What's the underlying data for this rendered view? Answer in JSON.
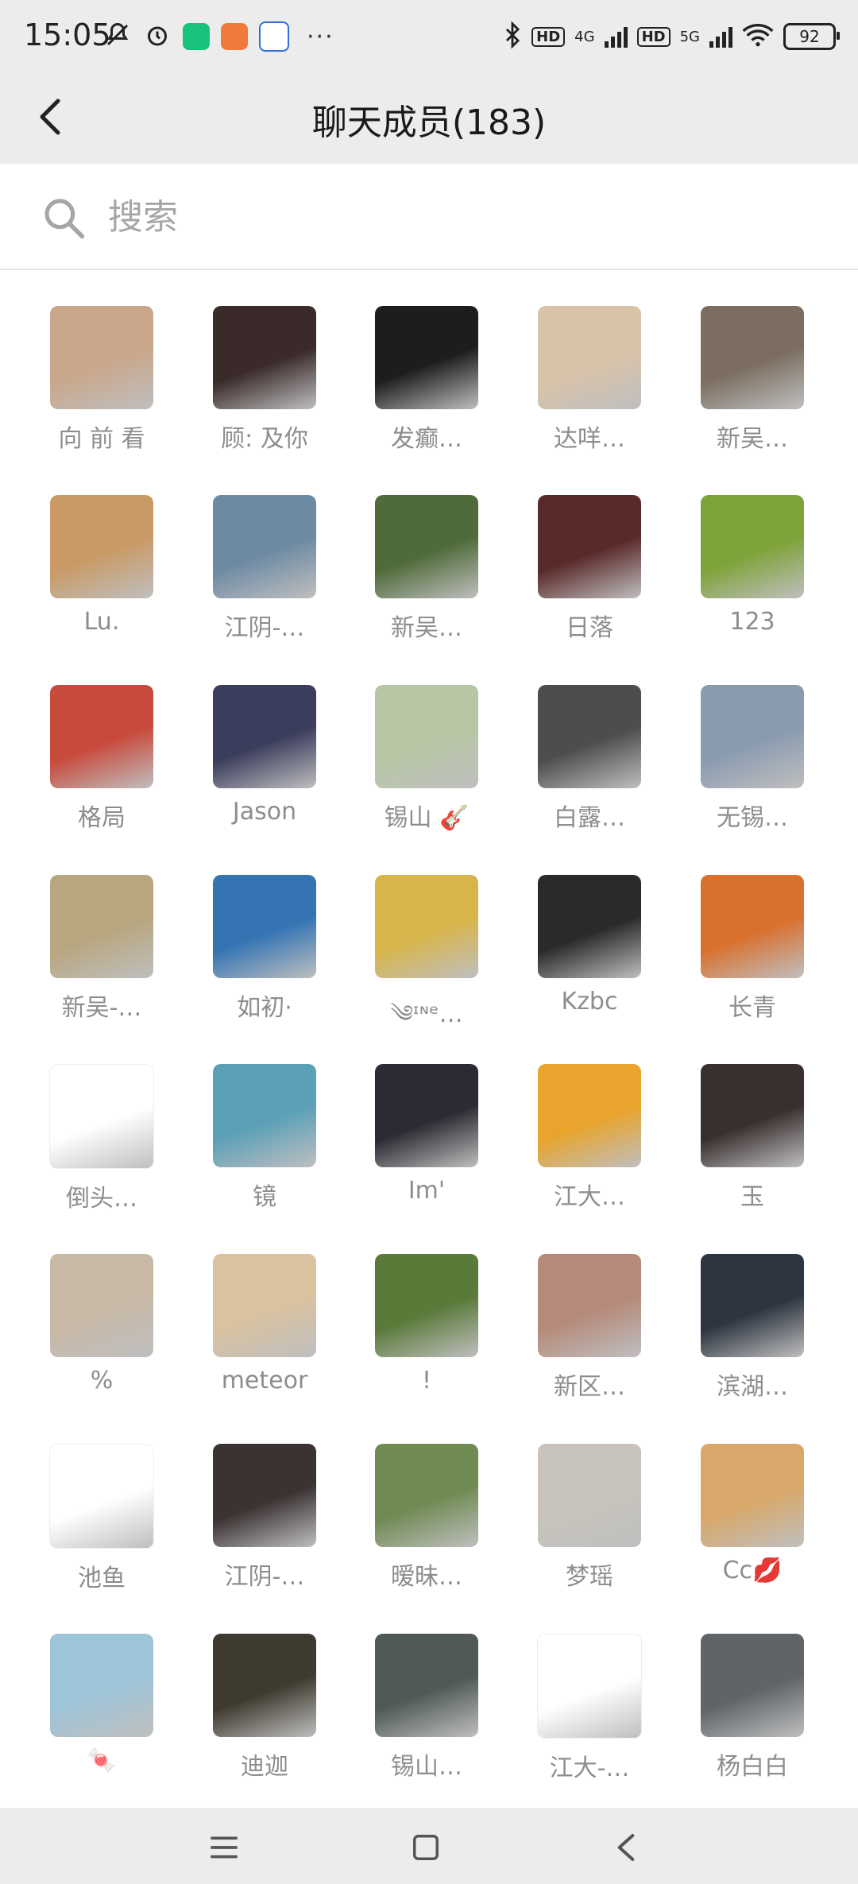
{
  "status_bar": {
    "time": "15:05",
    "network_1": "4G",
    "network_2": "5G",
    "hd": "HD",
    "battery": "92"
  },
  "header": {
    "title": "聊天成员(183)",
    "back_icon": "chevron-left-icon"
  },
  "search": {
    "placeholder": "搜索",
    "value": ""
  },
  "members": [
    {
      "name": "向 前 看",
      "color": "#c9a78b"
    },
    {
      "name": "顾: 及你",
      "color": "#3a2a2a"
    },
    {
      "name": "发癫…",
      "color": "#1d1d1d"
    },
    {
      "name": "达咩…",
      "color": "#d9c3a8"
    },
    {
      "name": "新吴…",
      "color": "#7b6e60"
    },
    {
      "name": "Lu.",
      "color": "#c99a66"
    },
    {
      "name": "江阴-…",
      "color": "#6d8aa3"
    },
    {
      "name": "新吴…",
      "color": "#4f6b3a"
    },
    {
      "name": "日落",
      "color": "#5a2a2a"
    },
    {
      "name": "123",
      "color": "#7ea33a"
    },
    {
      "name": "格局",
      "color": "#c84a3c"
    },
    {
      "name": "Jason",
      "color": "#3b3d5c"
    },
    {
      "name": "锡山 🎸",
      "color": "#b7c7a5"
    },
    {
      "name": "白露…",
      "color": "#4d4d4d"
    },
    {
      "name": "无锡…",
      "color": "#8a9bb0"
    },
    {
      "name": "新吴-…",
      "color": "#b8a67e"
    },
    {
      "name": "如初·",
      "color": "#3474b3"
    },
    {
      "name": "༄ᶦᶰᵉ…",
      "color": "#d8b54a"
    },
    {
      "name": "Kzbc",
      "color": "#2a2a2a"
    },
    {
      "name": "长青",
      "color": "#d9702e"
    },
    {
      "name": "倒头…",
      "color": "#ffffff"
    },
    {
      "name": "镜",
      "color": "#5ca0b8"
    },
    {
      "name": "Im'",
      "color": "#2b2b33"
    },
    {
      "name": "江大…",
      "color": "#e8a42c"
    },
    {
      "name": "玉",
      "color": "#3a2f2f"
    },
    {
      "name": "%",
      "color": "#c8b9a7"
    },
    {
      "name": "meteor",
      "color": "#d9c2a0"
    },
    {
      "name": "!",
      "color": "#5a7a3a"
    },
    {
      "name": "新区…",
      "color": "#b58a7a"
    },
    {
      "name": "滨湖…",
      "color": "#2d3540"
    },
    {
      "name": "池鱼",
      "color": "#ffffff"
    },
    {
      "name": "江阴-…",
      "color": "#3b3232"
    },
    {
      "name": "暧昧…",
      "color": "#6f8a52"
    },
    {
      "name": "梦瑶",
      "color": "#c8c4bc"
    },
    {
      "name": "Cc💋",
      "color": "#d8a86a"
    },
    {
      "name": "🍬",
      "color": "#9ec4d8"
    },
    {
      "name": "迪迦",
      "color": "#3f3a2f"
    },
    {
      "name": "锡山…",
      "color": "#4f5a55"
    },
    {
      "name": "江大-…",
      "color": "#ffffff"
    },
    {
      "name": "杨白白",
      "color": "#5e6468"
    }
  ],
  "nav": {
    "menu_icon": "menu-icon",
    "home_icon": "home-square-icon",
    "back_icon": "back-triangle-icon"
  }
}
